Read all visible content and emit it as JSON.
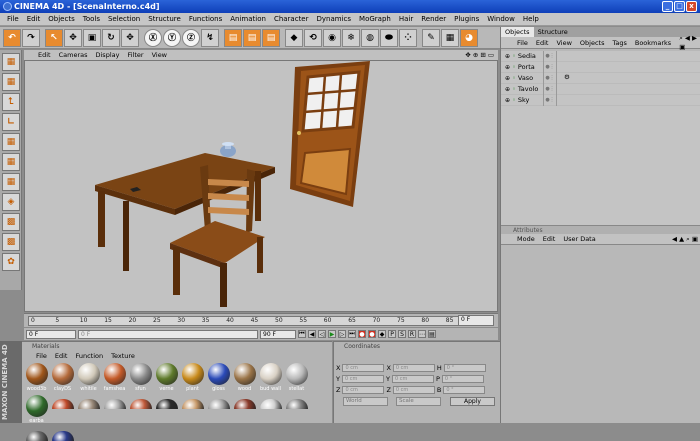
{
  "window": {
    "title": "CINEMA 4D - [ScenaInterno.c4d]",
    "btn_min": "_",
    "btn_max": "□",
    "btn_close": "x"
  },
  "menu": [
    "File",
    "Edit",
    "Objects",
    "Tools",
    "Selection",
    "Structure",
    "Functions",
    "Animation",
    "Character",
    "Dynamics",
    "MoGraph",
    "Hair",
    "Render",
    "Plugins",
    "Window",
    "Help"
  ],
  "toolbar": {
    "icons": [
      "↶",
      "↷",
      "↖",
      "✥",
      "▣",
      "↻",
      "✥",
      "Ⓧ",
      "Ⓨ",
      "Ⓩ",
      "↯",
      "▤",
      "▤",
      "▤",
      "◆",
      "⟲",
      "◉",
      "❄",
      "◍",
      "⬬",
      "⁘",
      "✎",
      "▦",
      "◕"
    ]
  },
  "left_tools": [
    "▦",
    "▦",
    "⮤",
    "∟",
    "▦",
    "▦",
    "▦",
    "◈",
    "▩",
    "▩",
    "✿"
  ],
  "viewport": {
    "menu": [
      "Edit",
      "Cameras",
      "Display",
      "Filter",
      "View"
    ],
    "nav_icons": "✥ ⊕ ⊞ ▭"
  },
  "timeline": {
    "ticks": [
      "0",
      "5",
      "10",
      "15",
      "20",
      "25",
      "30",
      "35",
      "40",
      "45",
      "50",
      "55",
      "60",
      "65",
      "70",
      "75",
      "80",
      "85",
      "90"
    ],
    "end_field": "0 F",
    "current": "0 F",
    "start": "0 F",
    "end": "90 F",
    "right_field": "0 F"
  },
  "materials": {
    "header": "Materials",
    "menu": [
      "File",
      "Edit",
      "Function",
      "Texture"
    ],
    "items": [
      {
        "label": "wood3b",
        "color": "#a0561a"
      },
      {
        "label": "clayDS",
        "color": "#b46a3a"
      },
      {
        "label": "whitile",
        "color": "#d0c8b8"
      },
      {
        "label": "famshea",
        "color": "#c45a28"
      },
      {
        "label": "sfun",
        "color": "#8a8a8a"
      },
      {
        "label": "verne",
        "color": "#5e7a2a"
      },
      {
        "label": "plant",
        "color": "#c88a1a"
      },
      {
        "label": "gloss",
        "color": "#2a4ab8"
      },
      {
        "label": "wood",
        "color": "#9a7448"
      },
      {
        "label": "bud wall",
        "color": "#d8d0c4"
      },
      {
        "label": "stellat",
        "color": "#b8b8b8"
      },
      {
        "label": "earba",
        "color": "#2f6a2a"
      }
    ],
    "row2_colors": [
      "#c04a2a",
      "#9a8a7a",
      "#aaaaaa",
      "#c05a3a",
      "#2a2a2a",
      "#c89a6a",
      "#a8a8a8",
      "#8a3a2a",
      "#d0d0d0",
      "#888888",
      "#6a6a6a",
      "#2a3a8a"
    ]
  },
  "coordinates": {
    "header": "Coordinates",
    "rows": [
      {
        "a": "X",
        "av": "0 cm",
        "b": "X",
        "bv": "0 cm",
        "c": "H",
        "cv": "0 °"
      },
      {
        "a": "Y",
        "av": "0 cm",
        "b": "Y",
        "bv": "0 cm",
        "c": "P",
        "cv": "0 °"
      },
      {
        "a": "Z",
        "av": "0 cm",
        "b": "Z",
        "bv": "0 cm",
        "c": "B",
        "cv": "0 °"
      }
    ],
    "world": "World",
    "scale": "Scale",
    "apply": "Apply"
  },
  "objects_panel": {
    "tabs": [
      "Objects",
      "Structure"
    ],
    "menu": [
      "File",
      "Edit",
      "View",
      "Objects",
      "Tags",
      "Bookmarks"
    ],
    "items": [
      {
        "name": "Sedia",
        "tags": ""
      },
      {
        "name": "Porta",
        "tags": ""
      },
      {
        "name": "Vaso",
        "tags": "⚙"
      },
      {
        "name": "Tavolo",
        "tags": ""
      },
      {
        "name": "Sky",
        "tags": ""
      }
    ]
  },
  "attributes_panel": {
    "header": "Attributes",
    "menu": [
      "Mode",
      "Edit",
      "User Data"
    ]
  },
  "maxon": "MAXON CINEMA 4D"
}
